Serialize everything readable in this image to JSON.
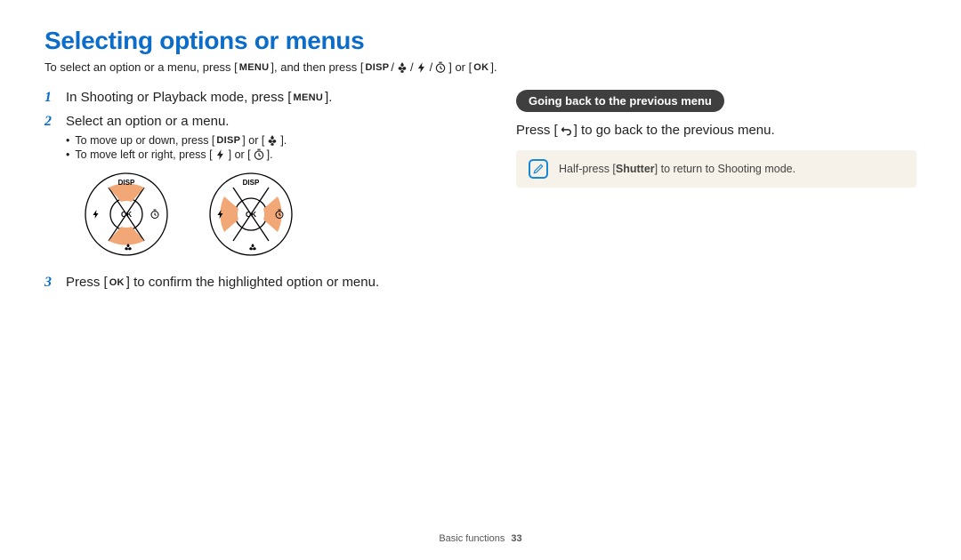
{
  "title": "Selecting options or menus",
  "intro_parts": {
    "a": "To select an option or a menu, press [",
    "b": "], and then press [",
    "c": "] or [",
    "d": "]."
  },
  "labels": {
    "menu": "MENU",
    "disp": "DISP",
    "ok": "OK"
  },
  "steps": {
    "s1_num": "1",
    "s1_a": "In Shooting or Playback mode, press [",
    "s1_b": "].",
    "s2_num": "2",
    "s2": "Select an option or a menu.",
    "s2_sub1_a": "To move up or down, press [",
    "s2_sub1_b": "] or [",
    "s2_sub1_c": "].",
    "s2_sub2_a": "To move left or right, press [",
    "s2_sub2_b": "] or [",
    "s2_sub2_c": "].",
    "s3_num": "3",
    "s3_a": "Press [",
    "s3_b": "] to confirm the highlighted option or menu."
  },
  "right": {
    "heading": "Going back to the previous menu",
    "line_a": "Press [",
    "line_b": "] to go back to the previous menu.",
    "tip_a": "Half-press [",
    "tip_bold": "Shutter",
    "tip_b": "] to return to Shooting mode."
  },
  "footer": {
    "section": "Basic functions",
    "page": "33"
  }
}
